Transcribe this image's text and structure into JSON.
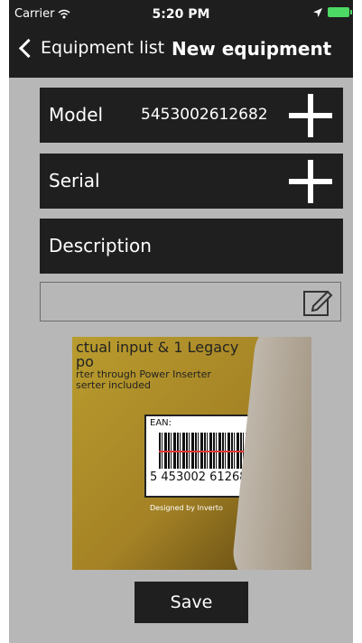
{
  "status": {
    "carrier": "Carrier",
    "time": "5:20 PM"
  },
  "nav": {
    "back_label": "Equipment list",
    "title": "New equipment"
  },
  "fields": {
    "model": {
      "label": "Model",
      "value": "5453002612682"
    },
    "serial": {
      "label": "Serial",
      "value": ""
    },
    "description": {
      "label": "Description"
    }
  },
  "photo": {
    "header_line1": "ctual input & 1 Legacy po",
    "header_line2": "rter through Power Inserter",
    "header_line3": "serter included",
    "ean_label": "EAN:",
    "digits": "5  453002  612682",
    "meta": "Designed by Inverto"
  },
  "actions": {
    "save_label": "Save"
  },
  "colors": {
    "toolbar_bg": "#1e1e1e",
    "content_bg": "#b7b7b7",
    "battery": "#4cd964"
  },
  "icons": {
    "wifi": "wifi-icon",
    "location": "location-arrow-icon",
    "battery": "battery-icon",
    "back": "chevron-left-icon",
    "add": "plus-icon",
    "edit": "edit-icon"
  }
}
